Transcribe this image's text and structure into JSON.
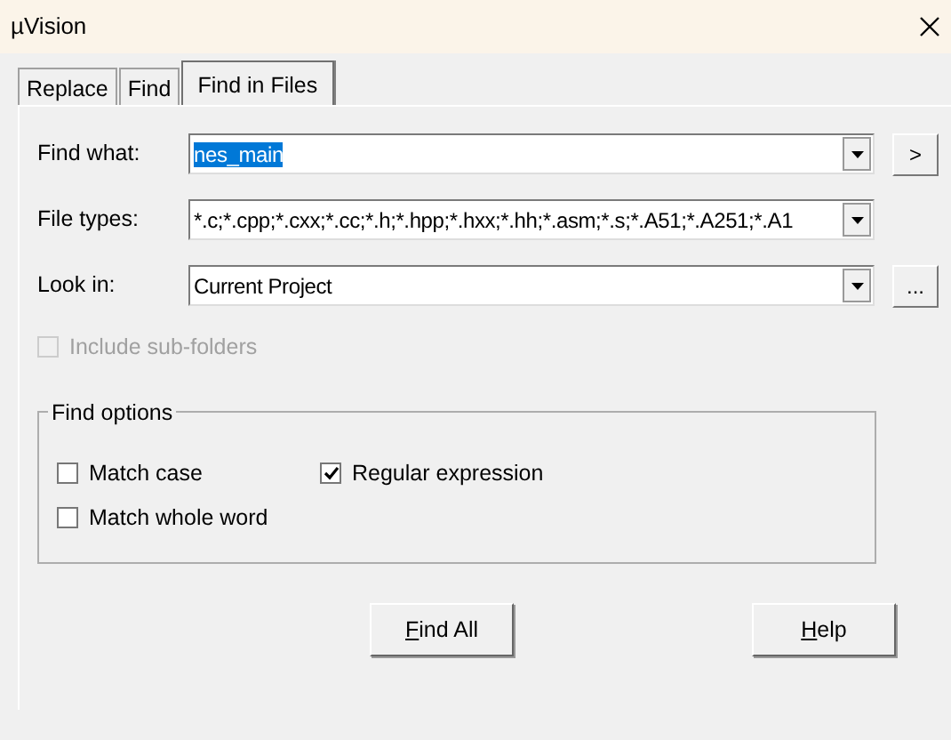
{
  "window": {
    "title": "µVision"
  },
  "tabs": [
    {
      "label": "Replace",
      "selected": false
    },
    {
      "label": "Find",
      "selected": false
    },
    {
      "label": "Find in Files",
      "selected": true
    }
  ],
  "fields": [
    {
      "label": "Find what:",
      "value": "nes_main",
      "text_selected": true,
      "side_button": ">"
    },
    {
      "label": "File types:",
      "value": "*.c;*.cpp;*.cxx;*.cc;*.h;*.hpp;*.hxx;*.hh;*.asm;*.s;*.A51;*.A251;*.A1",
      "text_selected": false
    },
    {
      "label": "Look in:",
      "value": "Current Project",
      "text_selected": false,
      "side_button": "..."
    }
  ],
  "include_subfolders": {
    "label": "Include sub-folders",
    "checked": false,
    "disabled": true
  },
  "find_options": {
    "title": "Find options",
    "options": [
      {
        "label": "Match case",
        "checked": false
      },
      {
        "label": "Regular expression",
        "checked": true
      },
      {
        "label": "Match whole word",
        "checked": false
      }
    ]
  },
  "buttons": [
    {
      "label": "Find All",
      "mnemonic": true
    },
    {
      "label": "Help",
      "mnemonic": true
    }
  ]
}
